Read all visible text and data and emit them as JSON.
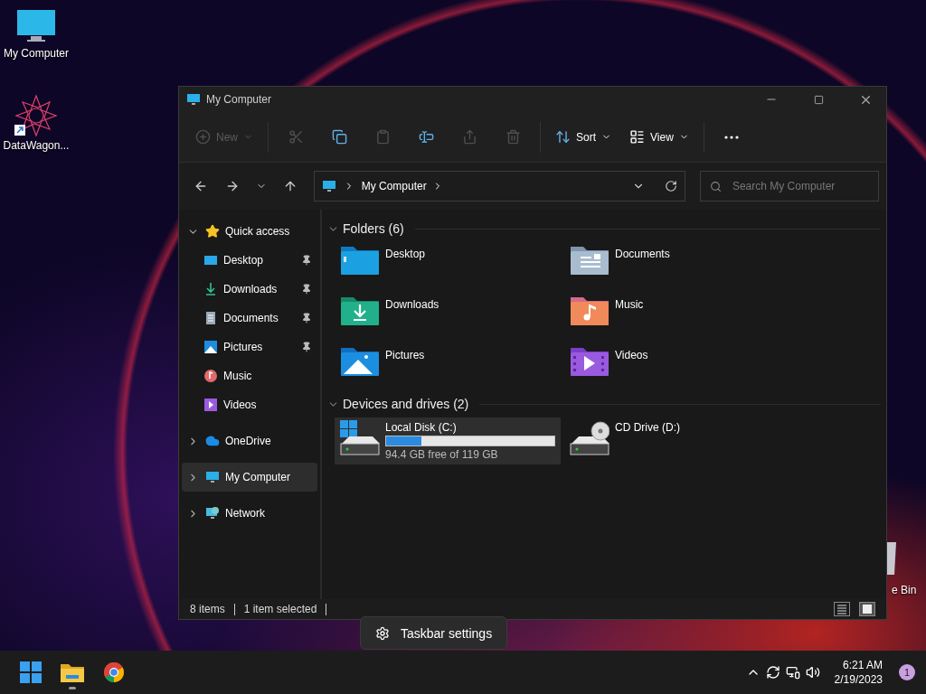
{
  "desktop_icons": [
    {
      "label": "My Computer",
      "kind": "computer"
    },
    {
      "label": "DataWagon...",
      "kind": "app"
    },
    {
      "label": "e Bin",
      "kind": "bin"
    }
  ],
  "window": {
    "title": "My Computer"
  },
  "toolbar": [
    {
      "kind": "new",
      "label": "New",
      "disabled": true
    },
    {
      "kind": "separator"
    },
    {
      "kind": "cut",
      "disabled": true
    },
    {
      "kind": "copy",
      "disabled": false
    },
    {
      "kind": "paste",
      "disabled": true
    },
    {
      "kind": "rename",
      "disabled": false
    },
    {
      "kind": "share",
      "disabled": true
    },
    {
      "kind": "delete",
      "disabled": true
    },
    {
      "kind": "separator"
    },
    {
      "kind": "sort",
      "label": "Sort",
      "disabled": false
    },
    {
      "kind": "view",
      "label": "View",
      "disabled": false
    },
    {
      "kind": "separator"
    },
    {
      "kind": "more",
      "disabled": false
    }
  ],
  "address": {
    "path": "My Computer",
    "search_placeholder": "Search My Computer"
  },
  "sidebar": [
    {
      "label": "Quick access",
      "kind": "star",
      "expanded": true,
      "selected": false,
      "children": [
        {
          "label": "Desktop",
          "kind": "desktop",
          "pinned": true,
          "selected": false
        },
        {
          "label": "Downloads",
          "kind": "downloads",
          "pinned": true,
          "selected": false
        },
        {
          "label": "Documents",
          "kind": "documents",
          "pinned": true,
          "selected": false
        },
        {
          "label": "Pictures",
          "kind": "pictures",
          "pinned": true,
          "selected": false
        },
        {
          "label": "Music",
          "kind": "music",
          "pinned": false,
          "selected": false
        },
        {
          "label": "Videos",
          "kind": "videos",
          "pinned": false,
          "selected": false
        }
      ]
    },
    {
      "label": "OneDrive",
      "kind": "cloud",
      "expanded": false,
      "selected": false
    },
    {
      "label": "My Computer",
      "kind": "computer",
      "expanded": false,
      "selected": true
    },
    {
      "label": "Network",
      "kind": "network",
      "expanded": false,
      "selected": false
    }
  ],
  "folders": {
    "title": "Folders (6)",
    "expanded": true,
    "items": [
      {
        "label": "Desktop",
        "kind": "desktop"
      },
      {
        "label": "Documents",
        "kind": "documents"
      },
      {
        "label": "Downloads",
        "kind": "downloads"
      },
      {
        "label": "Music",
        "kind": "music"
      },
      {
        "label": "Pictures",
        "kind": "pictures"
      },
      {
        "label": "Videos",
        "kind": "videos"
      }
    ]
  },
  "drives": {
    "title": "Devices and drives (2)",
    "expanded": true,
    "items": [
      {
        "label": "Local Disk (C:)",
        "kind": "disk",
        "level": 0.21,
        "free": "94.4 GB free of 119 GB",
        "selected": true
      },
      {
        "label": "CD Drive (D:)",
        "kind": "cd",
        "selected": false
      }
    ]
  },
  "status_bar": {
    "items": "8 items",
    "selection": "1 item selected",
    "views": [
      {
        "kind": "details",
        "selected": false
      },
      {
        "kind": "tiles",
        "selected": true
      }
    ]
  },
  "tooltip": "Taskbar settings",
  "taskbar": {
    "apps": [
      {
        "kind": "start",
        "running": false
      },
      {
        "kind": "explorer",
        "running": true
      },
      {
        "kind": "chrome",
        "running": false
      }
    ],
    "time": "6:21 AM",
    "date": "2/19/2023",
    "notifications": "1"
  }
}
